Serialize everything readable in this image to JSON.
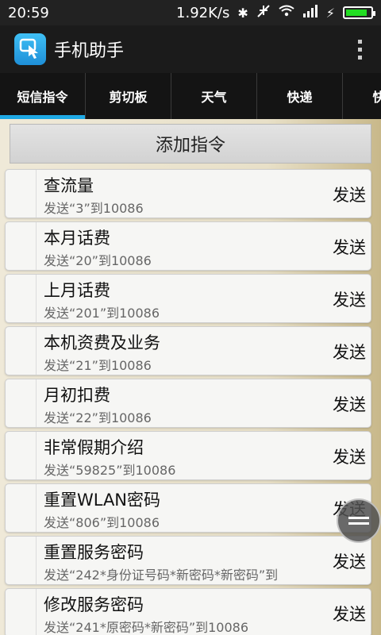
{
  "status": {
    "time": "20:59",
    "speed": "1.92K/s",
    "battery_level": 0.85
  },
  "app": {
    "title": "手机助手"
  },
  "tabs": [
    {
      "label": "短信指令",
      "active": true
    },
    {
      "label": "剪切板"
    },
    {
      "label": "天气"
    },
    {
      "label": "快递"
    },
    {
      "label": "快递"
    }
  ],
  "add_button": "添加指令",
  "send_label": "发送",
  "commands": [
    {
      "name": "查流量",
      "cmd": "发送“3”到10086"
    },
    {
      "name": "本月话费",
      "cmd": "发送“20”到10086"
    },
    {
      "name": "上月话费",
      "cmd": "发送“201”到10086"
    },
    {
      "name": "本机资费及业务",
      "cmd": "发送“21”到10086"
    },
    {
      "name": "月初扣费",
      "cmd": "发送“22”到10086"
    },
    {
      "name": "非常假期介绍",
      "cmd": "发送“59825”到10086"
    },
    {
      "name": "重置WLAN密码",
      "cmd": "发送“806”到10086"
    },
    {
      "name": "重置服务密码",
      "cmd": "发送“242*身份证号码*新密码*新密码”到"
    },
    {
      "name": "修改服务密码",
      "cmd": "发送“241*原密码*新密码”到10086"
    }
  ],
  "icons": {
    "app": "hand-touch-icon",
    "menu": "overflow-menu-icon",
    "float": "floating-menu-icon"
  }
}
